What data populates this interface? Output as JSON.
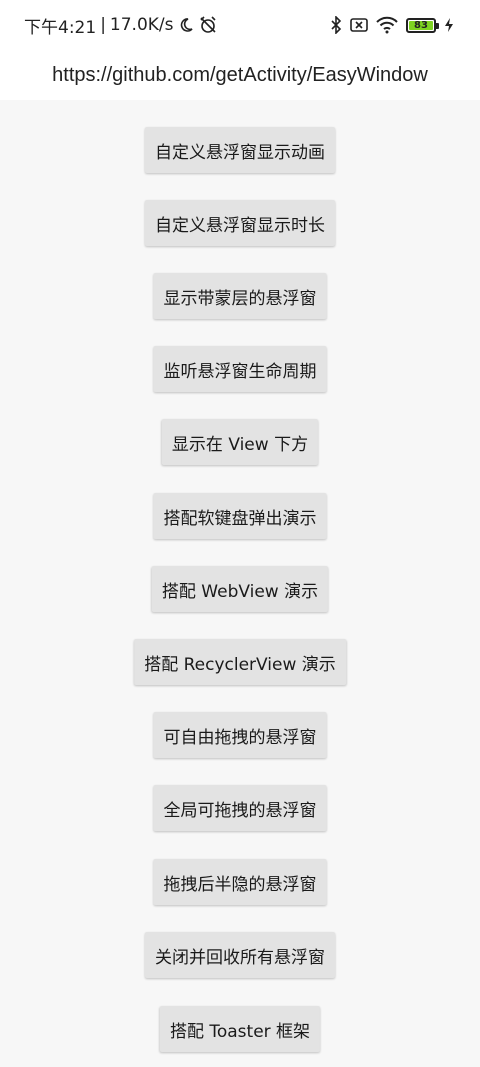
{
  "status_bar": {
    "time": "下午4:21",
    "separator": "|",
    "net_speed": "17.0K/s",
    "battery_level": "83",
    "icons": [
      "moon-icon",
      "alarm-off-icon",
      "bluetooth-icon",
      "sim-x-icon",
      "wifi-icon",
      "battery-icon",
      "charging-icon"
    ]
  },
  "title": "https://github.com/getActivity/EasyWindow",
  "buttons": [
    {
      "label": "自定义悬浮窗显示动画"
    },
    {
      "label": "自定义悬浮窗显示时长"
    },
    {
      "label": "显示带蒙层的悬浮窗"
    },
    {
      "label": "监听悬浮窗生命周期"
    },
    {
      "label": "显示在 View 下方"
    },
    {
      "label": "搭配软键盘弹出演示"
    },
    {
      "label": "搭配 WebView 演示"
    },
    {
      "label": "搭配 RecyclerView 演示"
    },
    {
      "label": "可自由拖拽的悬浮窗"
    },
    {
      "label": "全局可拖拽的悬浮窗"
    },
    {
      "label": "拖拽后半隐的悬浮窗"
    },
    {
      "label": "关闭并回收所有悬浮窗"
    },
    {
      "label": "搭配 Toaster 框架"
    }
  ]
}
